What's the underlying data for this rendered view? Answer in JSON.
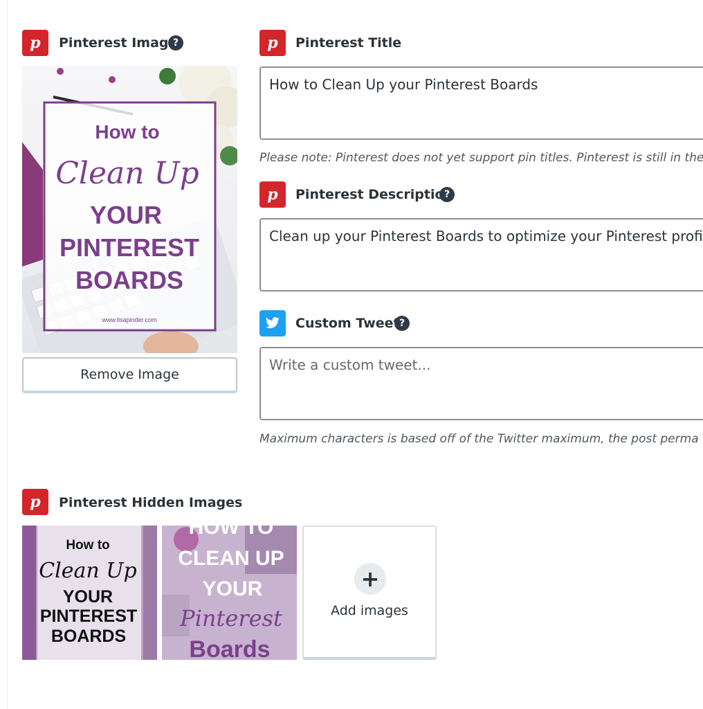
{
  "pinterest_image": {
    "label": "Pinterest Image",
    "help": "?",
    "overlay": {
      "line1": "How to",
      "line2": "Clean Up",
      "line3": "YOUR",
      "line4": "PINTEREST",
      "line5": "BOARDS",
      "url": "www.lisapinder.com"
    },
    "remove_label": "Remove Image"
  },
  "pinterest_title": {
    "label": "Pinterest Title",
    "value": "How to Clean Up your Pinterest Boards",
    "note": "Please note: Pinterest does not yet support pin titles. Pinterest is still in the"
  },
  "pinterest_description": {
    "label": "Pinterest Description",
    "help": "?",
    "value": "Clean up your Pinterest Boards to optimize your Pinterest profile a"
  },
  "custom_tweet": {
    "label": "Custom Tweet",
    "help": "?",
    "placeholder": "Write a custom tweet...",
    "note": "Maximum characters is based off of the Twitter maximum, the post perma"
  },
  "hidden_images": {
    "label": "Pinterest Hidden Images",
    "thumb1": {
      "line1": "How to",
      "line2": "Clean Up",
      "line3": "YOUR",
      "line4": "PINTEREST",
      "line5": "BOARDS"
    },
    "thumb2": {
      "line1": "HOW TO",
      "line2": "CLEAN UP",
      "line3": "YOUR",
      "line4": "Pinterest",
      "line5": "Boards"
    },
    "add_label": "Add images",
    "add_icon": "+"
  },
  "colors": {
    "pinterest_red": "#d3262b",
    "twitter_blue": "#1da1f2",
    "purple": "#7b3f8c"
  }
}
